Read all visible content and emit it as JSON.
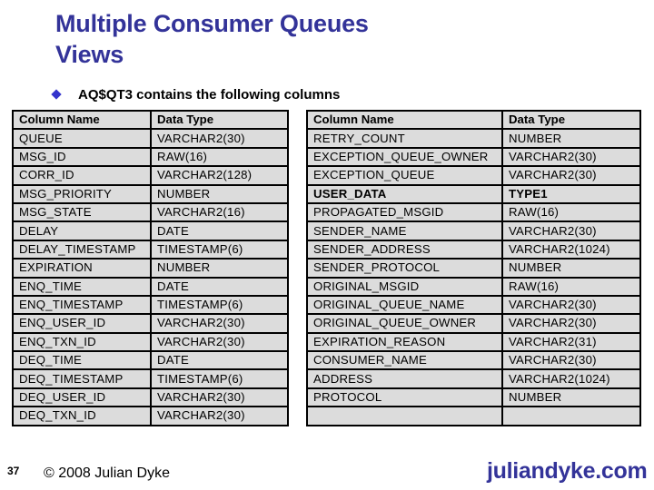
{
  "slide": {
    "title_line1": "Multiple Consumer Queues",
    "title_line2": "Views",
    "bullet": "AQ$QT3 contains the following columns",
    "slide_number": "37",
    "copyright": "© 2008 Julian Dyke",
    "site": "juliandyke.com",
    "accent_color": "#333399"
  },
  "left_table": {
    "headers": [
      "Column Name",
      "Data Type"
    ],
    "rows": [
      [
        "QUEUE",
        "VARCHAR2(30)"
      ],
      [
        "MSG_ID",
        "RAW(16)"
      ],
      [
        "CORR_ID",
        "VARCHAR2(128)"
      ],
      [
        "MSG_PRIORITY",
        "NUMBER"
      ],
      [
        "MSG_STATE",
        "VARCHAR2(16)"
      ],
      [
        "DELAY",
        "DATE"
      ],
      [
        "DELAY_TIMESTAMP",
        "TIMESTAMP(6)"
      ],
      [
        "EXPIRATION",
        "NUMBER"
      ],
      [
        "ENQ_TIME",
        "DATE"
      ],
      [
        "ENQ_TIMESTAMP",
        "TIMESTAMP(6)"
      ],
      [
        "ENQ_USER_ID",
        "VARCHAR2(30)"
      ],
      [
        "ENQ_TXN_ID",
        "VARCHAR2(30)"
      ],
      [
        "DEQ_TIME",
        "DATE"
      ],
      [
        "DEQ_TIMESTAMP",
        "TIMESTAMP(6)"
      ],
      [
        "DEQ_USER_ID",
        "VARCHAR2(30)"
      ],
      [
        "DEQ_TXN_ID",
        "VARCHAR2(30)"
      ]
    ]
  },
  "right_table": {
    "headers": [
      "Column Name",
      "Data Type"
    ],
    "rows": [
      [
        "RETRY_COUNT",
        "NUMBER"
      ],
      [
        "EXCEPTION_QUEUE_OWNER",
        "VARCHAR2(30)"
      ],
      [
        "EXCEPTION_QUEUE",
        "VARCHAR2(30)"
      ],
      [
        "USER_DATA",
        "TYPE1"
      ],
      [
        "PROPAGATED_MSGID",
        "RAW(16)"
      ],
      [
        "SENDER_NAME",
        "VARCHAR2(30)"
      ],
      [
        "SENDER_ADDRESS",
        "VARCHAR2(1024)"
      ],
      [
        "SENDER_PROTOCOL",
        "NUMBER"
      ],
      [
        "ORIGINAL_MSGID",
        "RAW(16)"
      ],
      [
        "ORIGINAL_QUEUE_NAME",
        "VARCHAR2(30)"
      ],
      [
        "ORIGINAL_QUEUE_OWNER",
        "VARCHAR2(30)"
      ],
      [
        "EXPIRATION_REASON",
        "VARCHAR2(31)"
      ],
      [
        "CONSUMER_NAME",
        "VARCHAR2(30)"
      ],
      [
        "ADDRESS",
        "VARCHAR2(1024)"
      ],
      [
        "PROTOCOL",
        "NUMBER"
      ],
      [
        "",
        ""
      ]
    ],
    "emphasized_row": "USER_DATA"
  }
}
